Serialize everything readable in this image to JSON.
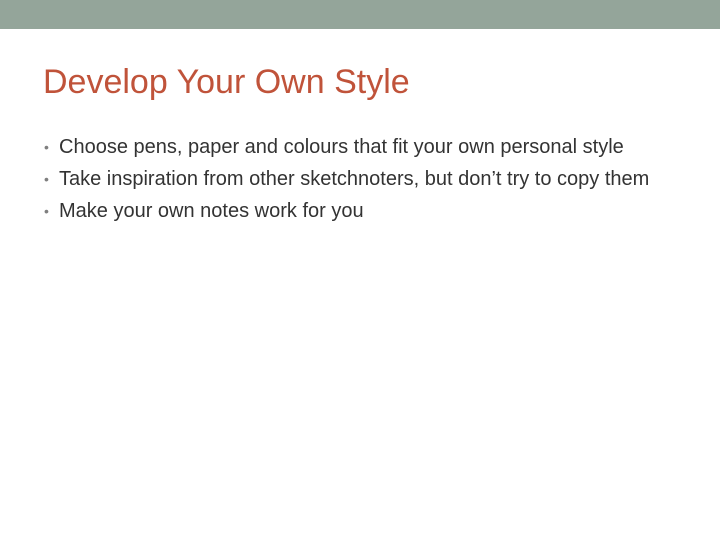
{
  "slide": {
    "title": "Develop Your Own Style",
    "bullet_marker": "•",
    "bullets": [
      {
        "text": "Choose pens, paper and colours that fit your own personal style"
      },
      {
        "text": "Take inspiration from other sketchnoters, but don’t try to copy them"
      },
      {
        "text": "Make your own notes work for you"
      }
    ]
  },
  "colors": {
    "top_band": "#94a59a",
    "title": "#c0533a",
    "body_text": "#333333",
    "bullet_marker": "#7f7f7f"
  }
}
